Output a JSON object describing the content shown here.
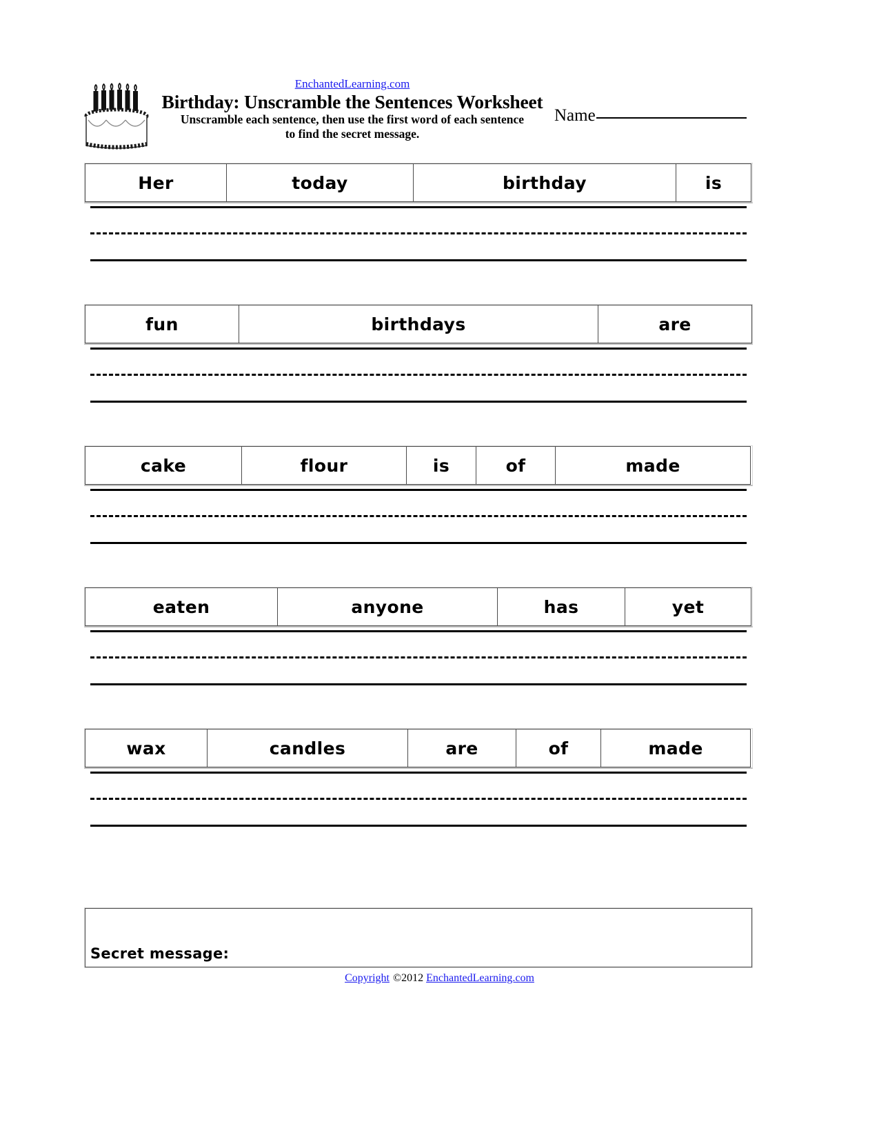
{
  "header": {
    "site_link": "EnchantedLearning.com",
    "title": "Birthday: Unscramble the Sentences Worksheet",
    "instructions_line1": "Unscramble each sentence, then use the first word of each sentence",
    "instructions_line2": "to find the secret message.",
    "name_label": "Name",
    "cake_icon": "birthday-cake-icon",
    "candle_count": 6
  },
  "rows": [
    {
      "index": 1,
      "words": [
        "Her",
        "today",
        "birthday",
        "is"
      ],
      "widths": [
        206,
        272,
        382,
        110
      ]
    },
    {
      "index": 2,
      "words": [
        "fun",
        "birthdays",
        "are"
      ],
      "widths": [
        224,
        522,
        224
      ]
    },
    {
      "index": 3,
      "words": [
        "cake",
        "flour",
        "is",
        "of",
        "made"
      ],
      "widths": [
        228,
        240,
        102,
        116,
        284
      ]
    },
    {
      "index": 4,
      "words": [
        "eaten",
        "anyone",
        "has",
        "yet"
      ],
      "widths": [
        280,
        320,
        186,
        184
      ]
    },
    {
      "index": 5,
      "words": [
        "wax",
        "candles",
        "are",
        "of",
        "made"
      ],
      "widths": [
        178,
        292,
        158,
        124,
        218
      ]
    }
  ],
  "secret": {
    "label": "Secret message:"
  },
  "footer": {
    "copyright_link": "Copyright",
    "copyright_mid": "©2012",
    "site_link": "EnchantedLearning.com"
  },
  "colors": {
    "link": "#1a1aee",
    "text": "#000000",
    "cell_border": "#4a4a4a",
    "outer_border": "#d9d9d9",
    "page_bg": "#ffffff"
  }
}
